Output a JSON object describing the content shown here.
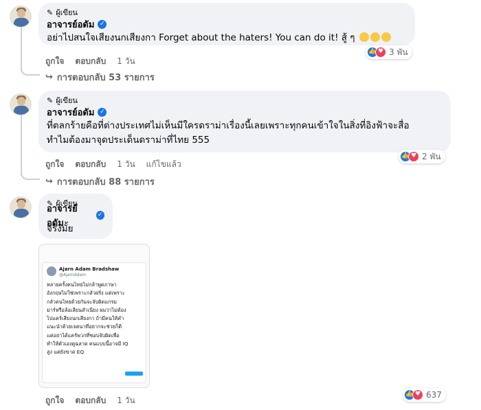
{
  "author_badge_label": "ผู้เขียน",
  "comments": [
    {
      "author": "อาจารย์อดัม",
      "text": "อย่าไปสนใจเสียงนกเสียงกา Forget about the haters! You can do it! สู้ ๆ",
      "text_lines": [],
      "reaction_count": "3 พัน",
      "actions": {
        "like": "ถูกใจ",
        "reply": "ตอบกลับ",
        "time": "1 วัน",
        "edited": ""
      },
      "replies_label": "การตอบกลับ 53 รายการ"
    },
    {
      "author": "อาจารย์อดัม",
      "text_lines": [
        "ที่ตลกร้ายคือที่ต่างประเทศไม่เห็นมีใครดราม่าเรื่องนี้เลยเพราะทุกคนเข้าใจในสิ่งที่อิงฟ้าจะสื่อ",
        "ทำไมต้องมาจุดประเด็นดราม่าที่ไทย 555"
      ],
      "reaction_count": "2 พัน",
      "actions": {
        "like": "ถูกใจ",
        "reply": "ตอบกลับ",
        "time": "1 วัน",
        "edited": "แก้ไขแล้ว"
      },
      "replies_label": "การตอบกลับ 88 รายการ"
    },
    {
      "author": "อาจารย์อดัม",
      "text": "จริงมั้ย",
      "reaction_count": "637",
      "actions": {
        "like": "ถูกใจ",
        "reply": "ตอบกลับ",
        "time": "1 วัน",
        "edited": ""
      },
      "attachment": {
        "tweet_author": "Ajarn Adam Bradshaw",
        "tweet_handle": "@AjarnAdam",
        "tweet_lines": [
          "หลายครั้งคนไทยไม่กล้าพูดภาษา",
          "อังกฤษไม่ใช่เพราะกลัวฝรั่ง แต่เพราะ",
          "กลัวคนไทยด้วยกันจะจับผิดแกรม",
          "ม่าร์หรือล้อเลียนสำเนียง ผมว่าไม่ต้อง",
          "ไปแคร์เสียงนกเสียงกา ถ้ามีคนให้คำ",
          "แนะนำด้วยเจตนาที่อยากจะช่วยก็ดี",
          "แต่อย่าได้แคร์พวกที่ชอบจับผิดเพื่อ",
          "ทำให้ตัวเองดูฉลาด คนแบบนี้อาจมี IQ",
          "สูง แต่ยังขาด EQ"
        ]
      }
    }
  ],
  "colors": {
    "bubble": "#f0f2f5",
    "meta_text": "#65676b",
    "verified": "#1b74e4",
    "like": "#1877f2",
    "love": "#f33e58"
  },
  "icons": [
    "author-badge-icon",
    "verified-icon",
    "like-reaction-icon",
    "love-reaction-icon",
    "reply-arrow-icon",
    "grinning-emoji-icon"
  ]
}
